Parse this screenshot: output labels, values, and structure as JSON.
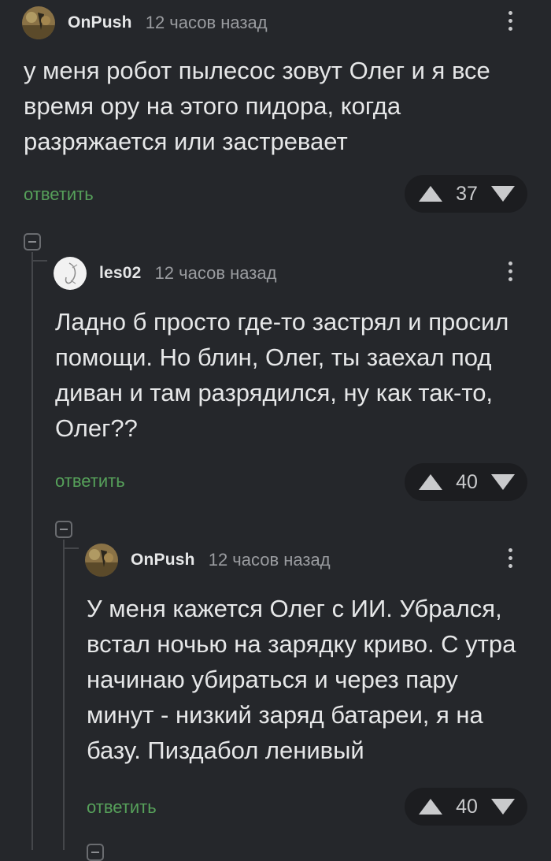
{
  "comments": [
    {
      "author": "OnPush",
      "time": "12 часов назад",
      "text": "у меня робот пылесос зовут Олег и я все время ору на этого пидора, когда разряжается или застревает",
      "reply_label": "ответить",
      "votes": "37"
    },
    {
      "author": "les02",
      "time": "12 часов назад",
      "text": "Ладно б просто где-то застрял и просил помощи. Но блин, Олег, ты заехал под диван и там разрядился, ну как так-то, Олег??",
      "reply_label": "ответить",
      "votes": "40"
    },
    {
      "author": "OnPush",
      "time": "12 часов назад",
      "text": "У меня кажется Олег с ИИ. Убрался, встал ночью на зарядку криво. С утра начинаю убираться и через пару минут - низкий заряд батареи, я на базу. Пиздабол ленивый",
      "reply_label": "ответить",
      "votes": "40"
    }
  ],
  "icons": {
    "more": "more-vertical-icon",
    "upvote": "arrow-up-icon",
    "downvote": "arrow-down-icon",
    "collapse": "collapse-thread-icon"
  },
  "colors": {
    "background": "#25272b",
    "reply_link": "#56a05a",
    "vote_pill": "#1c1d20"
  }
}
